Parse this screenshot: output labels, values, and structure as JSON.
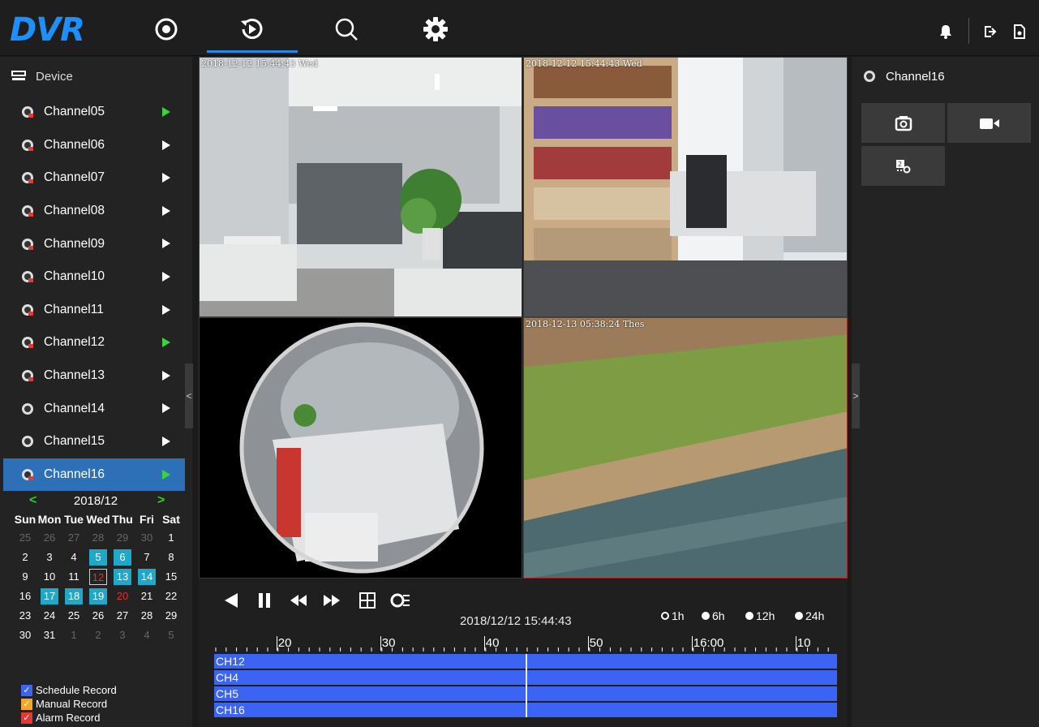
{
  "app": {
    "logo": "DVR"
  },
  "nav": {
    "items": [
      {
        "name": "live-view",
        "icon": "live-icon"
      },
      {
        "name": "playback",
        "icon": "playback-icon",
        "active": true
      },
      {
        "name": "search",
        "icon": "search-icon"
      },
      {
        "name": "settings",
        "icon": "gear-icon"
      }
    ],
    "right_icons": [
      "bell-icon",
      "logout-icon",
      "lock-icon"
    ]
  },
  "sidebar": {
    "header": "Device",
    "channels": [
      {
        "label": "Channel05",
        "playing": true
      },
      {
        "label": "Channel06",
        "playing": false
      },
      {
        "label": "Channel07",
        "playing": false
      },
      {
        "label": "Channel08",
        "playing": false
      },
      {
        "label": "Channel09",
        "playing": false
      },
      {
        "label": "Channel10",
        "playing": false
      },
      {
        "label": "Channel11",
        "playing": false
      },
      {
        "label": "Channel12",
        "playing": true
      },
      {
        "label": "Channel13",
        "playing": false
      },
      {
        "label": "Channel14",
        "playing": false
      },
      {
        "label": "Channel15",
        "playing": false
      },
      {
        "label": "Channel16",
        "playing": true,
        "selected": true
      }
    ],
    "collapse_symbol": "<"
  },
  "calendar": {
    "prev": "<",
    "next": ">",
    "month": "2018/12",
    "dow": [
      "Sun",
      "Mon",
      "Tue",
      "Wed",
      "Thu",
      "Fri",
      "Sat"
    ],
    "weeks": [
      [
        [
          "25",
          "other"
        ],
        [
          "26",
          "other"
        ],
        [
          "27",
          "other"
        ],
        [
          "28",
          "other"
        ],
        [
          "29",
          "other"
        ],
        [
          "30",
          "other"
        ],
        [
          "1",
          ""
        ]
      ],
      [
        [
          "2",
          ""
        ],
        [
          "3",
          ""
        ],
        [
          "4",
          ""
        ],
        [
          "5",
          "rec"
        ],
        [
          "6",
          "rec"
        ],
        [
          "7",
          ""
        ],
        [
          "8",
          ""
        ]
      ],
      [
        [
          "9",
          ""
        ],
        [
          "10",
          ""
        ],
        [
          "11",
          ""
        ],
        [
          "12",
          "today"
        ],
        [
          "13",
          "rec"
        ],
        [
          "14",
          "rec"
        ],
        [
          "15",
          ""
        ]
      ],
      [
        [
          "16",
          ""
        ],
        [
          "17",
          "rec"
        ],
        [
          "18",
          "rec"
        ],
        [
          "19",
          "rec"
        ],
        [
          "20",
          "alarm"
        ],
        [
          "21",
          ""
        ],
        [
          "22",
          ""
        ]
      ],
      [
        [
          "23",
          ""
        ],
        [
          "24",
          ""
        ],
        [
          "25",
          ""
        ],
        [
          "26",
          ""
        ],
        [
          "27",
          ""
        ],
        [
          "28",
          ""
        ],
        [
          "29",
          ""
        ]
      ],
      [
        [
          "30",
          ""
        ],
        [
          "31",
          ""
        ],
        [
          "1",
          "other"
        ],
        [
          "2",
          "other"
        ],
        [
          "3",
          "other"
        ],
        [
          "4",
          "other"
        ],
        [
          "5",
          "other"
        ]
      ]
    ],
    "legend": [
      {
        "label": "Schedule Record",
        "color": "#3b64f5"
      },
      {
        "label": "Manual Record",
        "color": "#f5a623"
      },
      {
        "label": "Alarm Record",
        "color": "#e53935"
      }
    ]
  },
  "videos": [
    {
      "osd": "2018-12-12 15:44:43 Wed"
    },
    {
      "osd": "2018-12-12 15:44:43 Wed"
    },
    {
      "osd": ""
    },
    {
      "osd": "2018-12-13 05:38:24 Thes"
    }
  ],
  "right_panel": {
    "header": "Channel16",
    "tools": [
      "snapshot-icon",
      "record-icon",
      "ptz-preset-icon"
    ],
    "collapse_symbol": ">"
  },
  "playback": {
    "time": "2018/12/12 15:44:43",
    "ranges": [
      {
        "label": "1h",
        "selected": true
      },
      {
        "label": "6h",
        "selected": false
      },
      {
        "label": "12h",
        "selected": false
      },
      {
        "label": "24h",
        "selected": false
      }
    ],
    "ticks": [
      "20",
      "30",
      "40",
      "50",
      "16:00",
      "10"
    ],
    "tracks": [
      "CH12",
      "CH4",
      "CH5",
      "CH16"
    ],
    "cursor_fraction": 0.5
  }
}
